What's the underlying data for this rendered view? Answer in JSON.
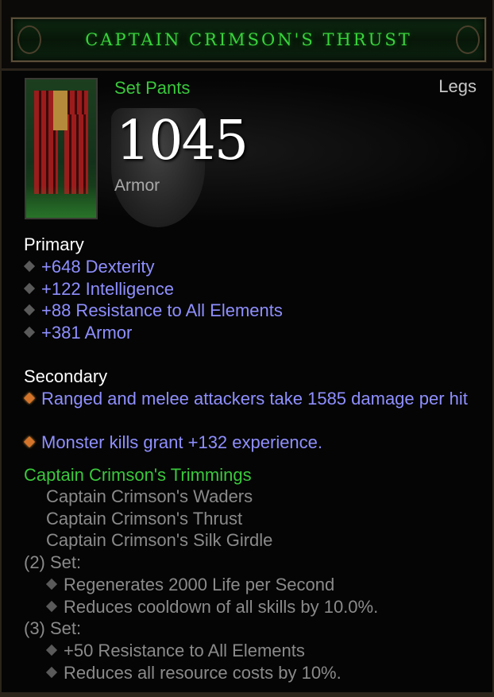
{
  "item": {
    "name": "CAPTAIN CRIMSON'S THRUST",
    "type": "Set Pants",
    "slot": "Legs",
    "armor_value": "1045",
    "armor_label": "Armor",
    "icon": "crimson-pants-icon"
  },
  "primary": {
    "heading": "Primary",
    "stats": [
      "+648 Dexterity",
      "+122 Intelligence",
      "+88 Resistance to All Elements",
      "+381 Armor"
    ]
  },
  "secondary": {
    "heading": "Secondary",
    "stats": [
      "Ranged and melee attackers take 1585 damage per hit",
      "Monster kills grant +132 experience."
    ]
  },
  "set": {
    "name": "Captain Crimson's Trimmings",
    "pieces": [
      "Captain Crimson's Waders",
      "Captain Crimson's Thrust",
      "Captain Crimson's Silk Girdle"
    ],
    "bonuses": [
      {
        "label": "(2) Set:",
        "effects": [
          "Regenerates 2000 Life per Second",
          "Reduces cooldown of all skills by 10.0%."
        ]
      },
      {
        "label": "(3) Set:",
        "effects": [
          "+50 Resistance to All Elements",
          "Reduces all resource costs by 10%."
        ]
      }
    ]
  },
  "colors": {
    "set_green": "#3ac83c",
    "magic_blue": "#8f8fff",
    "inactive_grey": "#8a8a8a",
    "bullet_orange": "#d4742b"
  }
}
